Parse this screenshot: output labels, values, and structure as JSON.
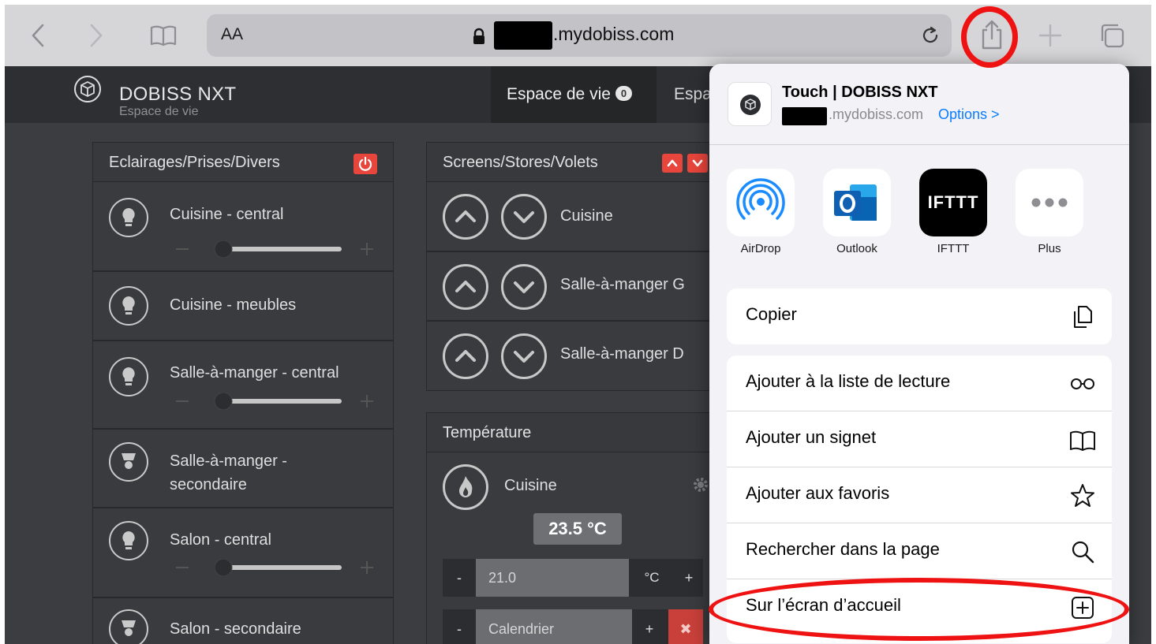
{
  "browser": {
    "text_size_label": "AA",
    "url_text": ".mydobiss.com",
    "icons": [
      "back-icon",
      "forward-icon",
      "bookmarks-icon",
      "lock-icon",
      "reload-icon",
      "share-icon",
      "new-tab-icon",
      "tabs-icon"
    ]
  },
  "app": {
    "brand": "DOBISS NXT",
    "brand_sub": "Espace de vie",
    "tabs": [
      {
        "label": "Espace de vie",
        "badge": "0"
      },
      {
        "label": "Espa"
      }
    ]
  },
  "lights_panel": {
    "title": "Eclairages/Prises/Divers",
    "items": [
      {
        "label": "Cuisine - central"
      },
      {
        "label": "Cuisine - meubles"
      },
      {
        "label": "Salle-à-manger - central"
      },
      {
        "label": "Salle-à-manger -"
      },
      {
        "label": "secondaire"
      },
      {
        "label": "Salon - central"
      },
      {
        "label": "Salon - secondaire"
      }
    ],
    "slider_minus": "−",
    "slider_plus": "+"
  },
  "screens_panel": {
    "title": "Screens/Stores/Volets",
    "items": [
      {
        "label": "Cuisine"
      },
      {
        "label": "Salle-à-manger G"
      },
      {
        "label": "Salle-à-manger D"
      }
    ]
  },
  "temp_panel": {
    "title": "Température",
    "room": "Cuisine",
    "current": "23.5 °C",
    "setpoint": "21.0",
    "unit": "°C",
    "minus": "-",
    "plus": "+",
    "schedule": "Calendrier",
    "clear": "✖"
  },
  "share_sheet": {
    "site_title": "Touch | DOBISS NXT",
    "site_url": ".mydobiss.com",
    "options_label": "Options >",
    "apps": [
      {
        "label": "AirDrop"
      },
      {
        "label": "Outlook"
      },
      {
        "label": "IFTTT",
        "icon_text": "IFTTT"
      },
      {
        "label": "Plus"
      }
    ],
    "copy_label": "Copier",
    "actions": [
      {
        "label": "Ajouter à la liste de lecture"
      },
      {
        "label": "Ajouter un signet"
      },
      {
        "label": "Ajouter aux favoris"
      },
      {
        "label": "Rechercher dans la page"
      },
      {
        "label": "Sur l’écran d’accueil"
      }
    ]
  },
  "colors": {
    "toolbar": "#d6d6d8",
    "page_bg": "#3b3d40",
    "accent_red": "#e8453c",
    "ios_blue": "#0a7cff",
    "annotation_red": "#ee1212"
  }
}
